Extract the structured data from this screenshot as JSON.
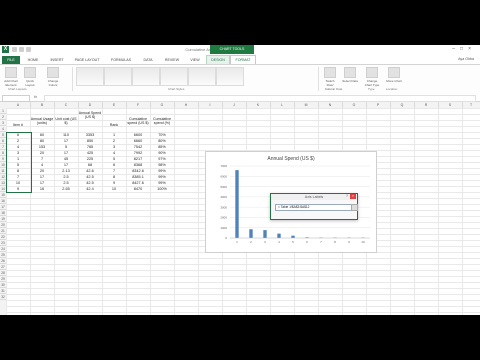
{
  "window": {
    "title": "Cumulative Annual Spend - Excel",
    "context_tab_group": "CHART TOOLS",
    "user": "Aya Ohba",
    "logo": "X"
  },
  "tabs": [
    "FILE",
    "HOME",
    "INSERT",
    "PAGE LAYOUT",
    "FORMULAS",
    "DATA",
    "REVIEW",
    "VIEW",
    "DESIGN",
    "FORMAT"
  ],
  "ribbon": {
    "buttons_left": [
      "Add Chart Element",
      "Quick Layout",
      "Change Colors"
    ],
    "buttons_right": [
      "Switch Row/ Column",
      "Select Data",
      "Change Chart Type",
      "Move Chart"
    ],
    "groups": [
      "Chart Layouts",
      "Chart Styles",
      "Data",
      "Type",
      "Location"
    ]
  },
  "formula_bar": {
    "fx": "fx",
    "value": ""
  },
  "columns": [
    "A",
    "B",
    "C",
    "D",
    "E",
    "F",
    "G",
    "H",
    "I",
    "J",
    "K",
    "L",
    "M",
    "N",
    "O",
    "P",
    "Q",
    "R",
    "S",
    "T"
  ],
  "rows": [
    "1",
    "2",
    "3",
    "4",
    "5",
    "6",
    "7",
    "8",
    "9",
    "10",
    "11",
    "12",
    "13",
    "14",
    "15",
    "16",
    "17",
    "18",
    "19",
    "20",
    "21",
    "22",
    "23",
    "24",
    "25",
    "26",
    "27",
    "28",
    "29",
    "30",
    "31",
    "32"
  ],
  "table": {
    "headers": [
      "Item #",
      "Annual Usage (units)",
      "Unit cost (US $)",
      "Annual Spend (US $)",
      "Rank",
      "Cumulative spend (US $)",
      "Cumulative spend (%)"
    ],
    "rows": [
      [
        "6",
        "60",
        "110",
        "3353",
        "1",
        "6600",
        "70%"
      ],
      [
        "2",
        "80",
        "17",
        "850",
        "2",
        "6660",
        "80%"
      ],
      [
        "4",
        "153",
        "5",
        "765",
        "3",
        "7542",
        "85%"
      ],
      [
        "3",
        "20",
        "17",
        "425",
        "4",
        "7992",
        "90%"
      ],
      [
        "1",
        "7",
        "45",
        "225",
        "5",
        "8217",
        "97%"
      ],
      [
        "5",
        "4",
        "17",
        "68",
        "6",
        "8368",
        "98%"
      ],
      [
        "8",
        "20",
        "2.13",
        "42.6",
        "7",
        "8342.6",
        "99%"
      ],
      [
        "7",
        "17",
        "2.5",
        "42.5",
        "8",
        "8385.1",
        "99%"
      ],
      [
        "10",
        "17",
        "2.5",
        "42.5",
        "9",
        "8427.6",
        "99%"
      ],
      [
        "9",
        "16",
        "2.65",
        "42.4",
        "10",
        "8470",
        "100%"
      ]
    ]
  },
  "chart": {
    "title": "Annual Spend (US $)",
    "y_ticks": [
      "7000",
      "6000",
      "5000",
      "4000",
      "3000",
      "2000",
      "1000",
      "0"
    ],
    "x_ticks": [
      "1",
      "2",
      "3",
      "4",
      "5",
      "6",
      "7",
      "8",
      "9",
      "10"
    ]
  },
  "chart_data": {
    "type": "bar",
    "title": "Annual Spend (US $)",
    "categories": [
      "1",
      "2",
      "3",
      "4",
      "5",
      "6",
      "7",
      "8",
      "9",
      "10"
    ],
    "values": [
      6600,
      850,
      765,
      425,
      225,
      68,
      42.6,
      42.5,
      42.5,
      42.4
    ],
    "ylim": [
      0,
      7000
    ],
    "xlabel": "",
    "ylabel": "",
    "bar_color": "#4f81bd"
  },
  "dialog": {
    "title": "Axis Labels",
    "help": "?",
    "close": "×",
    "range_value": "= Table 1!$A$3:$A$12"
  },
  "colors": {
    "excel_green": "#217346",
    "bar": "#4f81bd"
  }
}
